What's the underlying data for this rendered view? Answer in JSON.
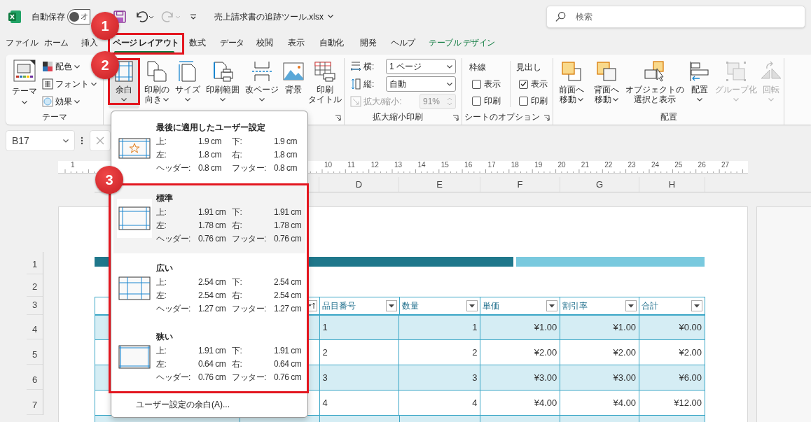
{
  "title_bar": {
    "autosave_label": "自動保存",
    "autosave_toggle": {
      "label": "オ",
      "on": false
    },
    "redo_disabled": true,
    "file_name": "売上請求書の追跡ツール.xlsx",
    "search": {
      "placeholder": "検索"
    }
  },
  "tabs": [
    {
      "label": "ファイル",
      "selected": false,
      "kind": "normal"
    },
    {
      "label": "ホーム",
      "selected": false,
      "kind": "normal"
    },
    {
      "label": "挿入",
      "selected": false,
      "kind": "normal"
    },
    {
      "label": "ページ レイアウト",
      "selected": true,
      "kind": "normal"
    },
    {
      "label": "数式",
      "selected": false,
      "kind": "normal"
    },
    {
      "label": "データ",
      "selected": false,
      "kind": "normal"
    },
    {
      "label": "校閲",
      "selected": false,
      "kind": "normal"
    },
    {
      "label": "表示",
      "selected": false,
      "kind": "normal"
    },
    {
      "label": "自動化",
      "selected": false,
      "kind": "normal"
    },
    {
      "label": "開発",
      "selected": false,
      "kind": "normal"
    },
    {
      "label": "ヘルプ",
      "selected": false,
      "kind": "normal"
    },
    {
      "label": "テーブル デザイン",
      "selected": false,
      "kind": "contextual"
    }
  ],
  "ribbon": {
    "groups": [
      {
        "kind": "theme",
        "label": "テーマ",
        "launcher": false,
        "big": {
          "label": "テーマ"
        },
        "small": [
          {
            "label": "配色"
          },
          {
            "label": "フォント"
          },
          {
            "label": "効果"
          }
        ]
      },
      {
        "kind": "buttons",
        "launcher": true,
        "buttons": [
          {
            "label_lines": [
              "余白"
            ],
            "dropdown": true,
            "selected": true,
            "disabled": false
          },
          {
            "label_lines": [
              "印刷の",
              "向き"
            ],
            "dropdown": true,
            "selected": false,
            "disabled": false
          },
          {
            "label_lines": [
              "サイズ"
            ],
            "dropdown": true,
            "selected": false,
            "disabled": false
          },
          {
            "label_lines": [
              "印刷範囲"
            ],
            "dropdown": true,
            "selected": false,
            "disabled": false
          },
          {
            "label_lines": [
              "改ページ"
            ],
            "dropdown": true,
            "selected": false,
            "disabled": false
          },
          {
            "label_lines": [
              "背景"
            ],
            "dropdown": false,
            "selected": false,
            "disabled": false
          },
          {
            "label_lines": [
              "印刷",
              "タイトル"
            ],
            "dropdown": false,
            "selected": false,
            "disabled": false
          }
        ]
      },
      {
        "kind": "scale",
        "label": "拡大縮小印刷",
        "launcher": true,
        "fields": [
          {
            "label": "横:",
            "value": "1 ページ",
            "disabled": false
          },
          {
            "label": "縦:",
            "value": "自動",
            "disabled": false
          },
          {
            "label": "拡大/縮小:",
            "value": "91%",
            "disabled": true
          }
        ]
      },
      {
        "kind": "options",
        "label": "シートのオプション",
        "launcher": true,
        "columns": [
          {
            "heading": "枠線",
            "items": [
              {
                "label": "表示",
                "checked": false
              },
              {
                "label": "印刷",
                "checked": false
              }
            ]
          },
          {
            "heading": "見出し",
            "items": [
              {
                "label": "表示",
                "checked": true
              },
              {
                "label": "印刷",
                "checked": false
              }
            ]
          }
        ]
      },
      {
        "kind": "buttons",
        "label": "配置",
        "launcher": false,
        "buttons": [
          {
            "label_lines": [
              "前面へ",
              "移動"
            ],
            "dropdown": true,
            "selected": false,
            "disabled": false
          },
          {
            "label_lines": [
              "背面へ",
              "移動"
            ],
            "dropdown": true,
            "selected": false,
            "disabled": false
          },
          {
            "label_lines": [
              "オブジェクトの",
              "選択と表示"
            ],
            "dropdown": false,
            "selected": false,
            "disabled": false
          },
          {
            "label_lines": [
              "配置"
            ],
            "dropdown": true,
            "selected": false,
            "disabled": false
          },
          {
            "label_lines": [
              "グループ化"
            ],
            "dropdown": true,
            "selected": false,
            "disabled": true
          },
          {
            "label_lines": [
              "回転"
            ],
            "dropdown": true,
            "selected": false,
            "disabled": true
          }
        ]
      }
    ]
  },
  "formula_bar": {
    "name_box": "B17"
  },
  "ruler": {
    "labels": [
      "1",
      "10",
      "11",
      "12",
      "13",
      "14",
      "15",
      "16",
      "17",
      "18",
      "19",
      "20",
      "21",
      "22",
      "23",
      "24",
      "25",
      "26",
      "27"
    ]
  },
  "column_headers": [
    "D",
    "E",
    "F",
    "G",
    "H"
  ],
  "row_headers": [
    "1",
    "2",
    "3",
    "4",
    "5",
    "6",
    "7"
  ],
  "table": {
    "columns": [
      {
        "label": "品目番号",
        "sorted": false
      },
      {
        "label": "数量",
        "sorted": false
      },
      {
        "label": "単価",
        "sorted": false
      },
      {
        "label": "割引率",
        "sorted": false
      },
      {
        "label": "合計",
        "sorted": false
      }
    ],
    "rows": [
      [
        "1",
        "1",
        "¥1.00",
        "¥1.00",
        "¥0.00"
      ],
      [
        "2",
        "2",
        "¥2.00",
        "¥2.00",
        "¥2.00"
      ],
      [
        "3",
        "3",
        "¥3.00",
        "¥3.00",
        "¥6.00"
      ],
      [
        "4",
        "4",
        "¥4.00",
        "¥4.00",
        "¥12.00"
      ]
    ]
  },
  "margins_menu": {
    "items": [
      {
        "kind": "custom",
        "title": "最後に適用したユーザー設定",
        "selected": false,
        "rows": [
          [
            "上:",
            "1.9 cm",
            "下:",
            "1.9 cm"
          ],
          [
            "左:",
            "1.8 cm",
            "右:",
            "1.8 cm"
          ],
          [
            "ヘッダー:",
            "0.8 cm",
            "フッター:",
            "0.8 cm"
          ]
        ]
      },
      {
        "kind": "normal",
        "title": "標準",
        "selected": true,
        "rows": [
          [
            "上:",
            "1.91 cm",
            "下:",
            "1.91 cm"
          ],
          [
            "左:",
            "1.78 cm",
            "右:",
            "1.78 cm"
          ],
          [
            "ヘッダー:",
            "0.76 cm",
            "フッター:",
            "0.76 cm"
          ]
        ]
      },
      {
        "kind": "wide",
        "title": "広い",
        "selected": false,
        "rows": [
          [
            "上:",
            "2.54 cm",
            "下:",
            "2.54 cm"
          ],
          [
            "左:",
            "2.54 cm",
            "右:",
            "2.54 cm"
          ],
          [
            "ヘッダー:",
            "1.27 cm",
            "フッター:",
            "1.27 cm"
          ]
        ]
      },
      {
        "kind": "narrow",
        "title": "狭い",
        "selected": false,
        "rows": [
          [
            "上:",
            "1.91 cm",
            "下:",
            "1.91 cm"
          ],
          [
            "左:",
            "0.64 cm",
            "右:",
            "0.64 cm"
          ],
          [
            "ヘッダー:",
            "0.76 cm",
            "フッター:",
            "0.76 cm"
          ]
        ]
      }
    ],
    "footer": "ユーザー設定の余白(A)..."
  },
  "annotations": [
    {
      "number": "1"
    },
    {
      "number": "2"
    },
    {
      "number": "3"
    }
  ]
}
